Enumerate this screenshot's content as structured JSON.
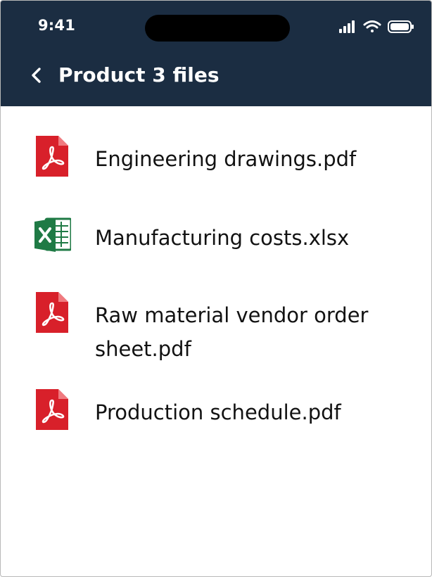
{
  "status_bar": {
    "time": "9:41",
    "icons": [
      "cellular-signal-icon",
      "wifi-icon",
      "battery-icon"
    ]
  },
  "header": {
    "back_icon": "chevron-left-icon",
    "title": "Product 3 files"
  },
  "files": [
    {
      "name": "Engineering drawings.pdf",
      "icon": "pdf-file-icon"
    },
    {
      "name": "Manufacturing costs.xlsx",
      "icon": "excel-file-icon"
    },
    {
      "name": "Raw material vendor order sheet.pdf",
      "icon": "pdf-file-icon"
    },
    {
      "name": "Production schedule.pdf",
      "icon": "pdf-file-icon"
    }
  ],
  "colors": {
    "header_background": "#1b2d42",
    "header_text": "#ffffff",
    "pdf_red": "#d8202a",
    "excel_green": "#1f7a45",
    "text": "#121212"
  }
}
